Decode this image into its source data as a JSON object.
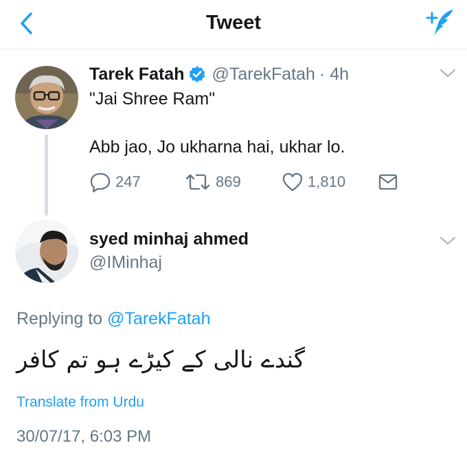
{
  "header": {
    "title": "Tweet",
    "back_icon": "chevron-left-icon",
    "compose_icon": "compose-tweet-icon",
    "accent": "#1da1f2"
  },
  "original_tweet": {
    "display_name": "Tarek Fatah",
    "verified": true,
    "handle": "@TarekFatah",
    "time": "· 4h",
    "text_line1": "\"Jai Shree Ram\"",
    "text_line2": "Abb jao, Jo ukharna hai, ukhar lo.",
    "replies": "247",
    "retweets": "869",
    "likes": "1,810"
  },
  "reply_tweet": {
    "display_name": "syed minhaj ahmed",
    "handle": "@IMinhaj",
    "replying_prefix": "Replying to",
    "replying_to": "@TarekFatah",
    "text": "گندے نالی کے کیڑے ہو تم کافر",
    "translate_label": "Translate from Urdu",
    "timestamp": "30/07/17, 6:03 PM"
  },
  "colors": {
    "text": "#14171a",
    "muted": "#657786",
    "accent": "#1da1f2",
    "border": "#e1e8ed"
  }
}
